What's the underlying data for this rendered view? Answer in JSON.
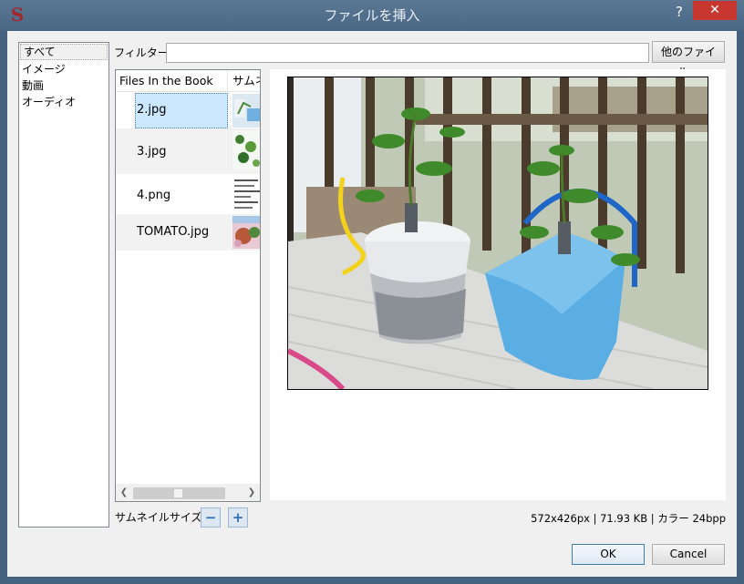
{
  "window": {
    "title": "ファイルを挿入",
    "app_logo": "S",
    "help_label": "?",
    "close_label": "✕"
  },
  "categories": [
    {
      "label": "すべて",
      "selected": true
    },
    {
      "label": "イメージ",
      "selected": false
    },
    {
      "label": "動画",
      "selected": false
    },
    {
      "label": "オーディオ",
      "selected": false
    }
  ],
  "filter": {
    "label": "フィルター:",
    "value": "",
    "other_files_button": "他のファイル..."
  },
  "file_list": {
    "columns": [
      "Files In the Book",
      "サムネ"
    ],
    "rows": [
      {
        "name": "2.jpg",
        "selected": true
      },
      {
        "name": "3.jpg",
        "selected": false
      },
      {
        "name": "4.png",
        "selected": false
      },
      {
        "name": "TOMATO.jpg",
        "selected": false
      }
    ]
  },
  "footer": {
    "thumbnail_size_label": "サムネイルサイズ:",
    "zoom_out": "−",
    "zoom_in": "+",
    "image_info": "572x426px | 71.93 KB | カラー 24bpp",
    "ok_label": "OK",
    "cancel_label": "Cancel"
  },
  "colors": {
    "title_bar": "#4f6d8a",
    "close_button": "#c7372f",
    "selection": "#cce8ff",
    "accent_button": "#3c7fb1"
  }
}
